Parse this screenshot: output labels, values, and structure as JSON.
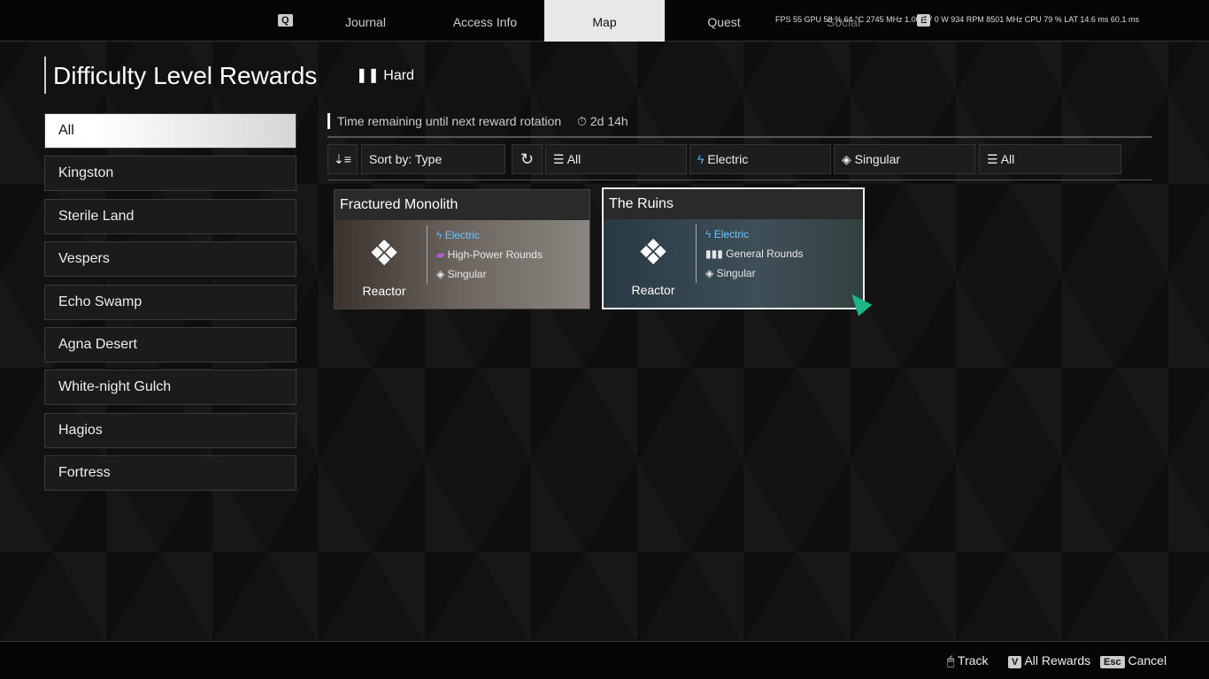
{
  "nav": {
    "key_left": "Q",
    "tabs": [
      "Journal",
      "Access Info",
      "Map",
      "Quest",
      "Social"
    ],
    "active": "Map",
    "key_right": "E"
  },
  "stats": "FPS 55 GPU 58 % 64 °C 2745 MHz 1.065 V 0 W 934 RPM 8501 MHz CPU 79 % LAT 14.6 ms 60.1 ms",
  "page_title": "Difficulty Level Rewards",
  "difficulty": "Hard",
  "sidebar": {
    "items": [
      "All",
      "Kingston",
      "Sterile Land",
      "Vespers",
      "Echo Swamp",
      "Agna Desert",
      "White-night Gulch",
      "Hagios",
      "Fortress"
    ],
    "active": "All"
  },
  "timer": {
    "label": "Time remaining until next reward rotation",
    "value": "2d 14h"
  },
  "filters": {
    "sort": "Sort by: Type",
    "type": "All",
    "attribute": "Electric",
    "ammo_kind": "Singular",
    "rounds": "All"
  },
  "cards": [
    {
      "title": "Fractured Monolith",
      "reward": "Reactor",
      "attribute": "Electric",
      "rounds": "High-Power Rounds",
      "kind": "Singular",
      "rounds_color": "#b65ee0"
    },
    {
      "title": "The Ruins",
      "reward": "Reactor",
      "attribute": "Electric",
      "rounds": "General Rounds",
      "kind": "Singular",
      "rounds_color": "#ffffff"
    }
  ],
  "footer": {
    "track": "Track",
    "all_rewards_key": "V",
    "all_rewards": "All Rewards",
    "cancel_key": "Esc",
    "cancel": "Cancel"
  },
  "colors": {
    "electric": "#4fb4ff"
  }
}
